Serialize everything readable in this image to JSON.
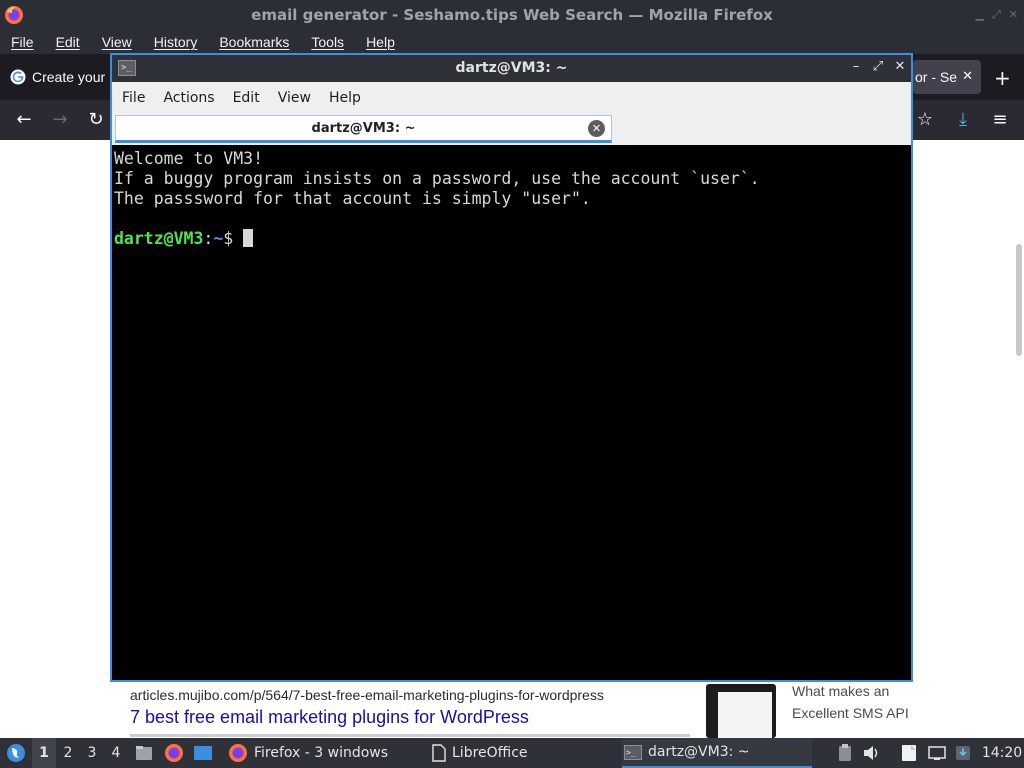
{
  "firefox": {
    "title": "email generator - Seshamo.tips Web Search — Mozilla Firefox",
    "menu": [
      "File",
      "Edit",
      "View",
      "History",
      "Bookmarks",
      "Tools",
      "Help"
    ],
    "tab_left_label": "Create your",
    "tab_right_label": "or - Se",
    "tab_close_glyph": "✕",
    "new_tab_glyph": "+"
  },
  "search_result": {
    "url": "articles.mujibo.com/p/564/7-best-free-email-marketing-plugins-for-wordpress",
    "title": "7 best free email marketing plugins for WordPress",
    "side_line1": "What makes an",
    "side_line2": "Excellent SMS API"
  },
  "terminal": {
    "window_title": "dartz@VM3: ~",
    "menu": [
      "File",
      "Actions",
      "Edit",
      "View",
      "Help"
    ],
    "tab_label": "dartz@VM3: ~",
    "lines": [
      "Welcome to VM3!",
      "If a buggy program insists on a password, use the account `user`.",
      "The passsword for that account is simply \"user\"."
    ],
    "prompt_user": "dartz@VM3",
    "prompt_sep": ":",
    "prompt_path": "~",
    "prompt_symbol": "$ "
  },
  "taskbar": {
    "workspaces": [
      "1",
      "2",
      "3",
      "4"
    ],
    "tasks": [
      "Firefox - 3 windows",
      "LibreOffice",
      "dartz@VM3: ~"
    ],
    "clock": "14:20"
  },
  "icons": {
    "firefox_icon": "firefox-icon",
    "google_icon": "google-icon",
    "terminal_icon": "terminal-icon"
  },
  "colors": {
    "accent": "#3c8ede",
    "prompt_user": "#53e34f",
    "prompt_path": "#5c8eff",
    "link": "#1a0dab"
  }
}
